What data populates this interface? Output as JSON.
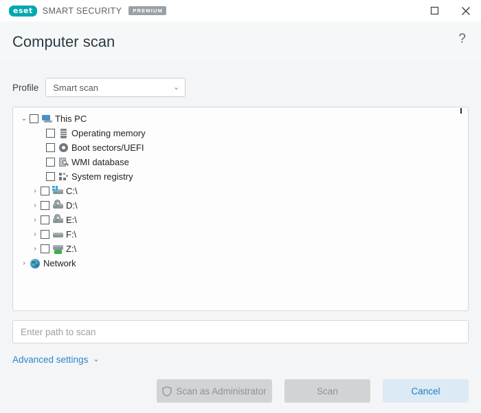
{
  "titlebar": {
    "logo_text": "eset",
    "product_name": "SMART SECURITY",
    "edition_badge": "PREMIUM",
    "maximize_icon": "maximize-icon",
    "close_icon": "close-icon"
  },
  "header": {
    "title": "Computer scan",
    "help_label": "?"
  },
  "profile": {
    "label": "Profile",
    "selected": "Smart scan",
    "chevron": "⌄"
  },
  "tree": {
    "items": [
      {
        "label": "This PC",
        "twisty": "⌄",
        "level": 1,
        "checkbox": true,
        "icon": "computer-icon"
      },
      {
        "label": "Operating memory",
        "twisty": "",
        "level": 2,
        "checkbox": true,
        "icon": "memory-icon"
      },
      {
        "label": "Boot sectors/UEFI",
        "twisty": "",
        "level": 2,
        "checkbox": true,
        "icon": "disc-icon"
      },
      {
        "label": "WMI database",
        "twisty": "",
        "level": 2,
        "checkbox": true,
        "icon": "wmi-icon"
      },
      {
        "label": "System registry",
        "twisty": "",
        "level": 2,
        "checkbox": true,
        "icon": "registry-icon"
      },
      {
        "label": "C:\\",
        "twisty": "›",
        "level": 3,
        "checkbox": true,
        "icon": "drive-system-icon"
      },
      {
        "label": "D:\\",
        "twisty": "›",
        "level": 3,
        "checkbox": true,
        "icon": "drive-optical-icon"
      },
      {
        "label": "E:\\",
        "twisty": "›",
        "level": 3,
        "checkbox": true,
        "icon": "drive-optical-icon"
      },
      {
        "label": "F:\\",
        "twisty": "›",
        "level": 3,
        "checkbox": true,
        "icon": "drive-icon"
      },
      {
        "label": "Z:\\",
        "twisty": "›",
        "level": 3,
        "checkbox": true,
        "icon": "drive-network-icon"
      },
      {
        "label": "Network",
        "twisty": "›",
        "level": 1,
        "checkbox": false,
        "icon": "network-globe-icon"
      }
    ]
  },
  "path_field": {
    "placeholder": "Enter path to scan",
    "value": ""
  },
  "advanced": {
    "label": "Advanced settings",
    "chevron": "⌄"
  },
  "footer": {
    "scan_as_admin": "Scan as Administrator",
    "scan": "Scan",
    "cancel": "Cancel"
  },
  "colors": {
    "brand_teal": "#00a8b0",
    "accent_blue": "#2d86c7",
    "cancel_bg": "#dbeaf4",
    "disabled_bg": "#d2d3d5"
  }
}
